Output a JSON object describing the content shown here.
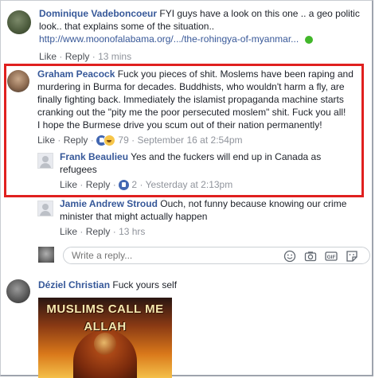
{
  "comments": [
    {
      "author": "Dominique Vadeboncoeur",
      "text_line1": " FYI guys have a look on this one .. a geo politic",
      "text_line2": "look.. that explains some of the situation..",
      "link": "http://www.moonofalabama.org/.../the-rohingya-of-myanmar...",
      "like": "Like",
      "reply": "Reply",
      "time": "13 mins"
    },
    {
      "author": "Graham Peacock",
      "text_line1": " Fuck you pieces of shit. Moslems have been raping and",
      "text_line2": "murdering in Burma for decades. Buddhists, who wouldn't harm a fly, are",
      "text_line3": "finally fighting back. Immediately the islamist propaganda machine starts",
      "text_line4": "cranking out the \"pity me the poor persecuted moslem\" shit. Fuck you all!",
      "text_line5": "I hope the Burmese drive you scum out of their nation permanently!",
      "like": "Like",
      "reply": "Reply",
      "reaction_count": "79",
      "time": "September 16 at 2:54pm"
    },
    {
      "author": "Frank Beaulieu",
      "text_line1": " Yes and the fuckers will end up in Canada as",
      "text_line2": "refugees",
      "like": "Like",
      "reply": "Reply",
      "reaction_count": "2",
      "time": "Yesterday at 2:13pm"
    },
    {
      "author": "Jamie Andrew Stroud",
      "text_line1": " Ouch, not funny because knowing our crime",
      "text_line2": "minister that might actually happen",
      "like": "Like",
      "reply": "Reply",
      "time": "13 hrs"
    },
    {
      "author": "Déziel Christian",
      "text_line1": " Fuck yours self"
    }
  ],
  "reply_box": {
    "placeholder": "Write a reply..."
  },
  "image_caption": {
    "line1": "MUSLIMS CALL ME",
    "line2": "ALLAH"
  },
  "icons": [
    "emoji-icon",
    "camera-icon",
    "gif-icon",
    "sticker-icon"
  ],
  "colors": {
    "name": "#365899",
    "highlight": "#e0201f",
    "like_blue": "#4267b2"
  }
}
